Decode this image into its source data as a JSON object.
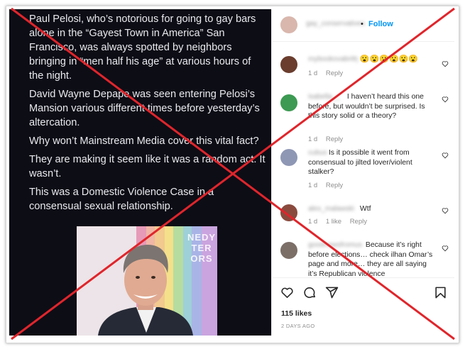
{
  "post": {
    "paragraphs": [
      "Paul Pelosi, who’s notorious for going to gay bars alone in the “Gayest Town in America” San Francisco, was always spotted by neighbors bringing in “men half his age” at various hours of the night.",
      "David Wayne Depape was seen entering Pelosi’s Mansion various different times before yesterday’s altercation.",
      "Why won’t Mainstream Media cover this vital fact?",
      "They are making it seem like it was a random act. It wasn’t.",
      "This was a Domestic Violence Case in a consensual sexual relationship."
    ],
    "photo_letters": "NEDY\nTER\nORS"
  },
  "header": {
    "username": "gay_conservatives",
    "separator": "•",
    "follow_label": "Follow"
  },
  "comments": [
    {
      "username": "mybookovabritty",
      "text": "😮😮😮😮😮😮",
      "time": "1 d",
      "likes": "",
      "reply": "Reply"
    },
    {
      "username": "isabella__",
      "text": "I haven’t heard this one before, but wouldn’t be surprised. Is this story solid or a theory?",
      "time": "1 d",
      "likes": "",
      "reply": "Reply"
    },
    {
      "username": "cubus",
      "text": "Is it possible it went from consensual to jilted lover/violent stalker?",
      "time": "1 d",
      "likes": "",
      "reply": "Reply"
    },
    {
      "username": "alex_malawski",
      "text": "Wtf",
      "time": "1 d",
      "likes": "1 like",
      "reply": "Reply"
    },
    {
      "username": "goodnewsfromus",
      "text": "Because it’s right before elections… check ilhan Omar’s page and more… they are all saying it’s Republican violence",
      "time": "",
      "likes": "",
      "reply": ""
    }
  ],
  "footer": {
    "likes": "115 likes",
    "timestamp": "2 DAYS AGO"
  },
  "colors": {
    "accent": "#0095f6",
    "cross": "#e0252b",
    "post_bg": "#0d0d16"
  },
  "icons": [
    "heart-icon",
    "comment-icon",
    "share-icon",
    "bookmark-icon"
  ]
}
